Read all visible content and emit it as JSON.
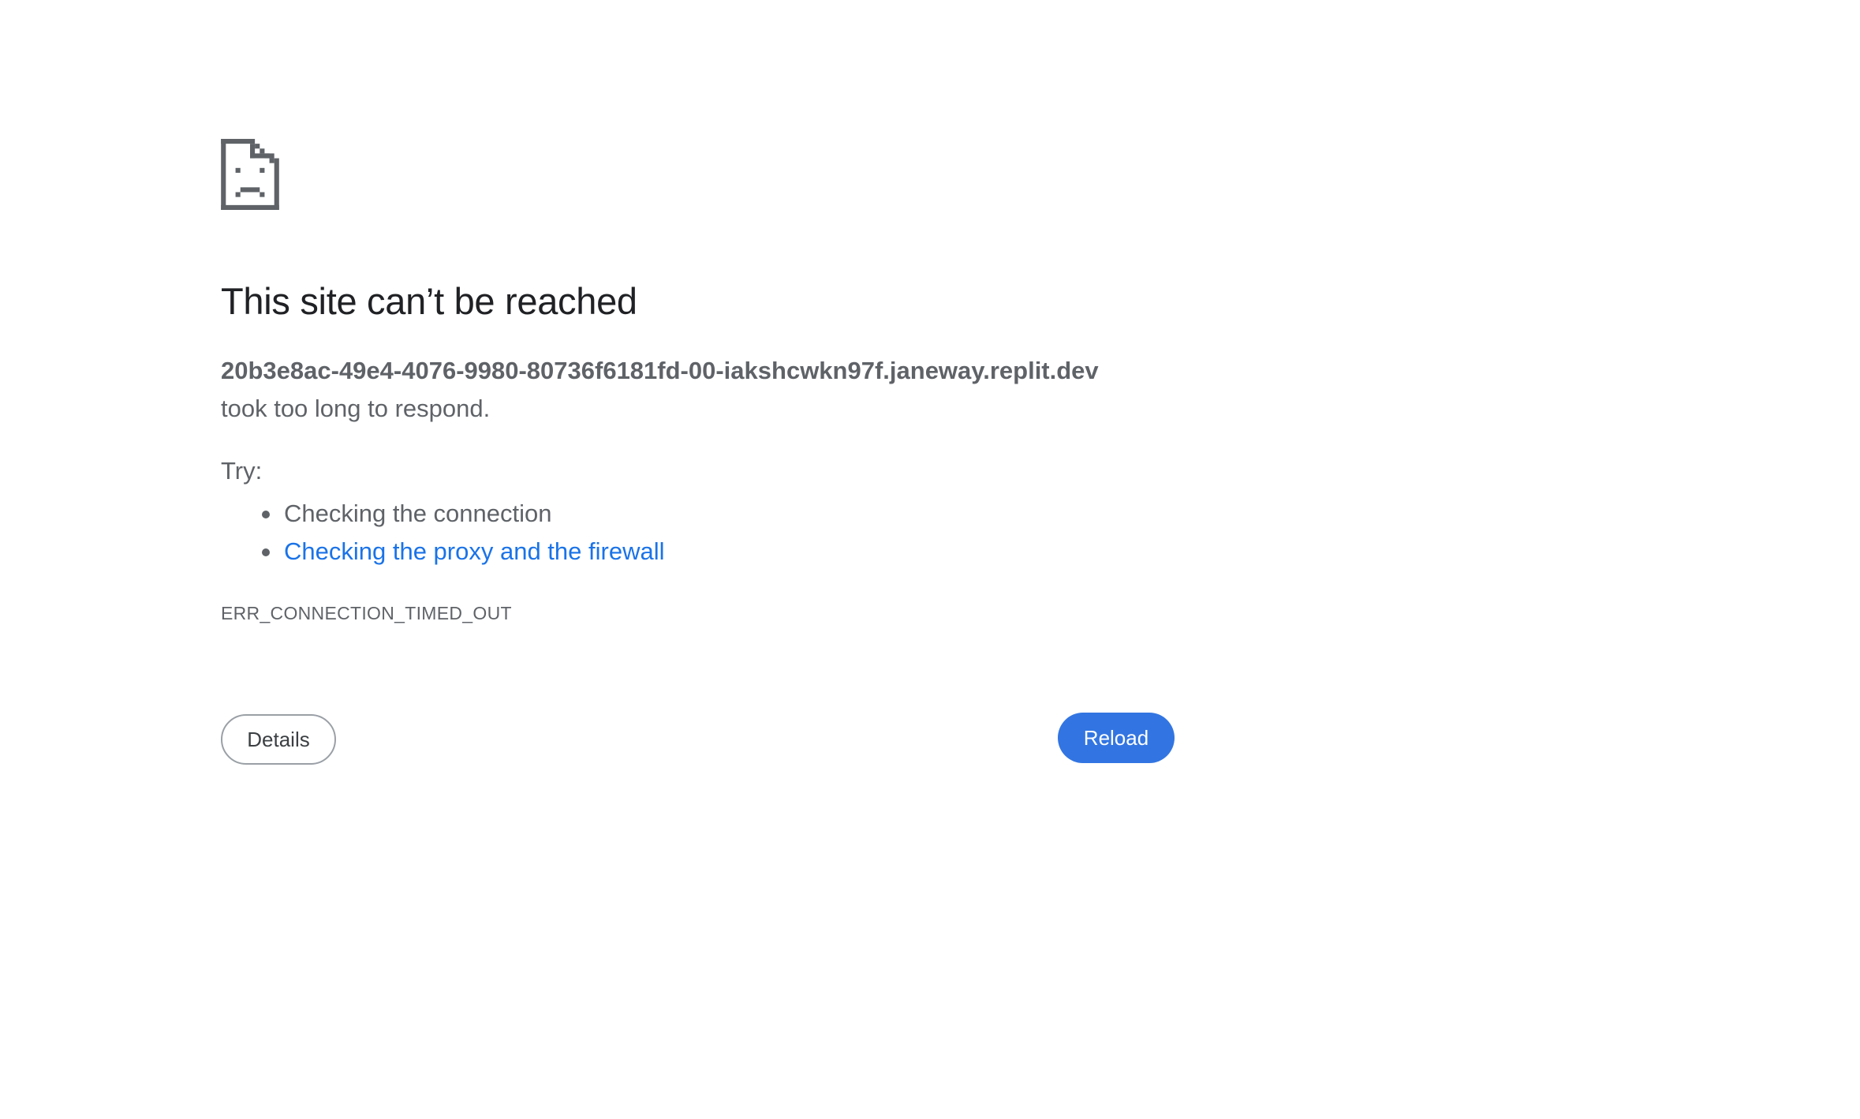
{
  "icon": "sad-page-icon",
  "error": {
    "title": "This site can’t be reached",
    "host": "20b3e8ac-49e4-4076-9980-80736f6181fd-00-iakshcwkn97f.janeway.replit.dev",
    "message_suffix": "took too long to respond.",
    "try_label": "Try:",
    "suggestions": [
      "Checking the connection",
      "Checking the proxy and the firewall"
    ],
    "code": "ERR_CONNECTION_TIMED_OUT"
  },
  "buttons": {
    "details_label": "Details",
    "reload_label": "Reload"
  },
  "colors": {
    "link": "#1a73e8",
    "reload_button": "#3275e2",
    "text": "#5f6368",
    "title": "#202124"
  }
}
